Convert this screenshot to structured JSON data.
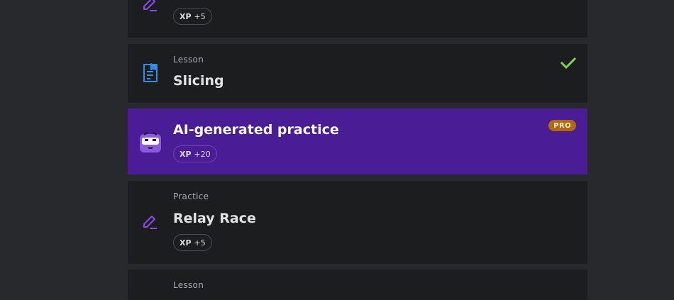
{
  "items": [
    {
      "type": "practice",
      "icon": "pencil-edit-icon",
      "title": "",
      "xp_label": "XP",
      "xp_value": "+5"
    },
    {
      "type": "lesson",
      "icon": "document-icon",
      "kind": "Lesson",
      "title": "Slicing",
      "completed": true,
      "status_icon": "check-icon"
    },
    {
      "type": "ai-practice",
      "icon": "robot-mascot-icon",
      "title": "AI-generated practice",
      "xp_label": "XP",
      "xp_value": "+20",
      "badge": "PRO"
    },
    {
      "type": "practice",
      "icon": "pencil-edit-icon",
      "kind": "Practice",
      "title": "Relay Race",
      "xp_label": "XP",
      "xp_value": "+5"
    },
    {
      "type": "lesson",
      "kind": "Lesson"
    }
  ],
  "colors": {
    "page_bg": "#27292c",
    "card_bg": "#1c1d1f",
    "pro_card_bg": "#4a1d96",
    "pro_badge_bg": "#b36a06",
    "check_color": "#7ad54a",
    "lesson_icon_color": "#2f8fe8",
    "practice_icon_color": "#8a4be8"
  }
}
